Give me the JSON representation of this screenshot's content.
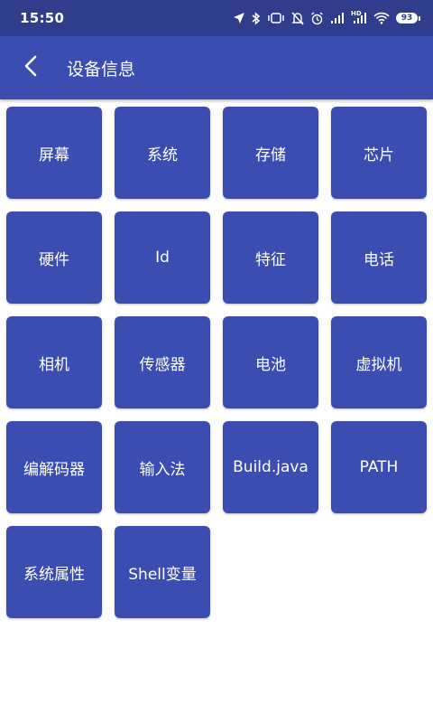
{
  "status_bar": {
    "time": "15:50",
    "battery": "93",
    "icons": [
      "location-arrow-icon",
      "bluetooth-icon",
      "vibrate-icon",
      "mute-bell-icon",
      "alarm-icon",
      "signal-icon",
      "hd-signal-icon",
      "wifi-icon",
      "battery-icon"
    ],
    "hd_label": "HD"
  },
  "app_bar": {
    "back_icon": "back-arrow-icon",
    "title": "设备信息"
  },
  "colors": {
    "status_bar": "#2f3d8c",
    "primary": "#3c4db1",
    "text": "#ffffff",
    "background": "#ffffff"
  },
  "tiles": [
    {
      "label": "屏幕"
    },
    {
      "label": "系统"
    },
    {
      "label": "存储"
    },
    {
      "label": "芯片"
    },
    {
      "label": "硬件"
    },
    {
      "label": "Id"
    },
    {
      "label": "特征"
    },
    {
      "label": "电话"
    },
    {
      "label": "相机"
    },
    {
      "label": "传感器"
    },
    {
      "label": "电池"
    },
    {
      "label": "虚拟机"
    },
    {
      "label": "编解码器"
    },
    {
      "label": "输入法"
    },
    {
      "label": "Build.java"
    },
    {
      "label": "PATH"
    },
    {
      "label": "系统属性"
    },
    {
      "label": "Shell变量"
    }
  ]
}
